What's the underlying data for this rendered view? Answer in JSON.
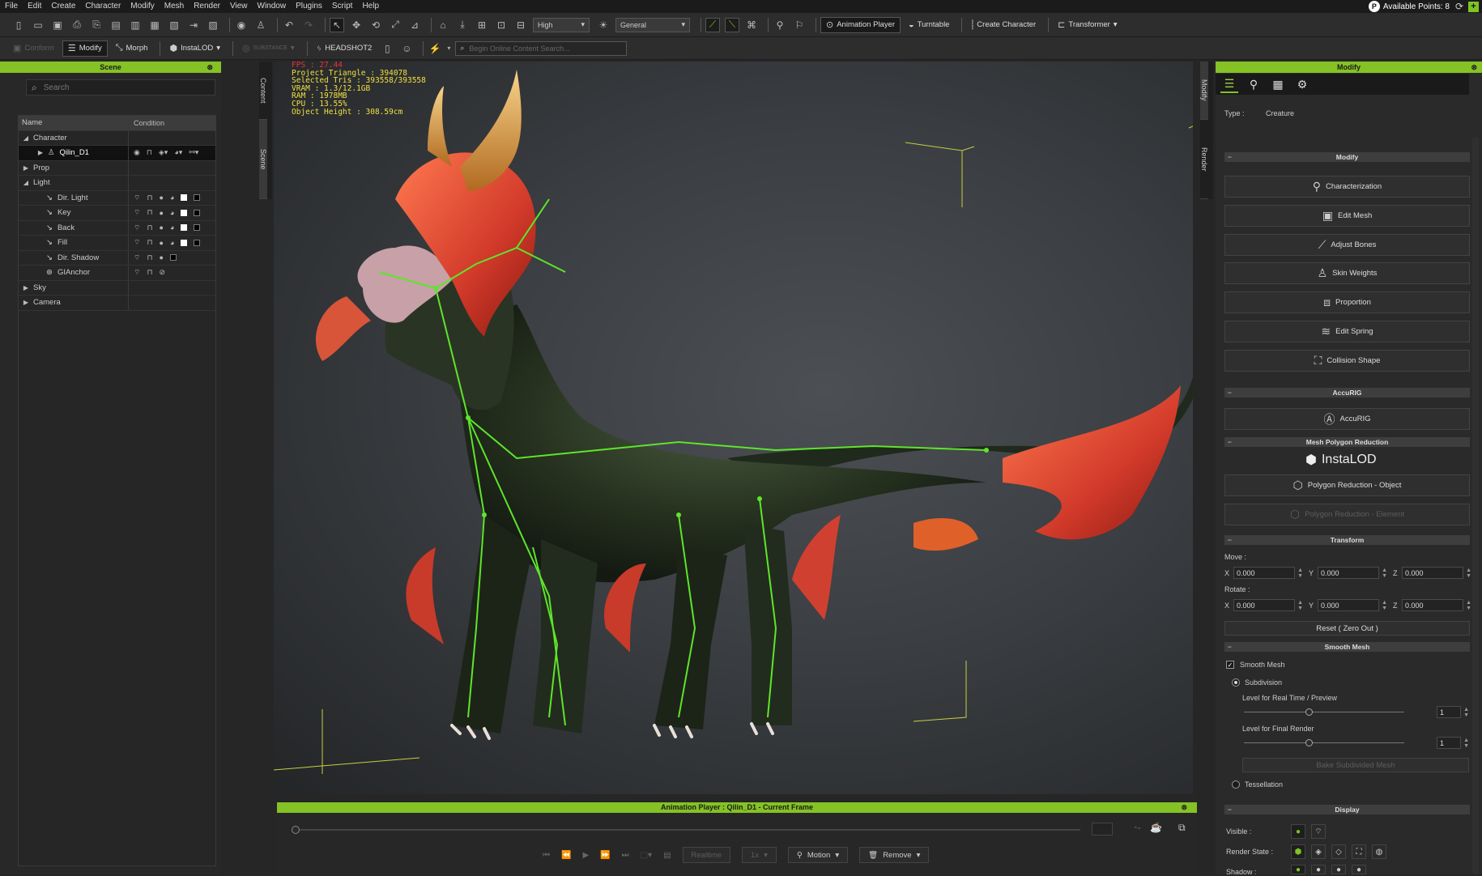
{
  "menu": [
    "File",
    "Edit",
    "Create",
    "Character",
    "Modify",
    "Mesh",
    "Render",
    "View",
    "Window",
    "Plugins",
    "Script",
    "Help"
  ],
  "points_label": "Available Points: 8",
  "toolbar1": {
    "quality": "High",
    "display_mode": "General",
    "animation_player": "Animation Player",
    "turntable": "Turntable",
    "create_character": "Create Character",
    "transformer": "Transformer"
  },
  "toolbar2": {
    "conform": "Conform",
    "modify": "Modify",
    "morph": "Morph",
    "instalod": "InstaLOD",
    "substance": "SUBSTANCE",
    "headshot": "HEADSHOT2",
    "search_placeholder": "Begin Online Content Search..."
  },
  "scene": {
    "title": "Scene",
    "search_placeholder": "Search",
    "col_name": "Name",
    "col_condition": "Condition",
    "rows": [
      {
        "label": "Character",
        "tri": "◢"
      },
      {
        "label": "Qilin_D1",
        "tri": "▶"
      },
      {
        "label": "Prop",
        "tri": "▶"
      },
      {
        "label": "Light",
        "tri": "◢"
      },
      {
        "label": "Dir. Light"
      },
      {
        "label": "Key"
      },
      {
        "label": "Back"
      },
      {
        "label": "Fill"
      },
      {
        "label": "Dir. Shadow"
      },
      {
        "label": "GIAnchor"
      },
      {
        "label": "Sky",
        "tri": "▶"
      },
      {
        "label": "Camera",
        "tri": "▶"
      }
    ]
  },
  "side_tabs_left": [
    "Content",
    "Scene"
  ],
  "side_tabs_right": [
    "Modify",
    "Render"
  ],
  "stats": {
    "fps": "FPS : 27.44",
    "project_triangle": "Project Triangle : 394078",
    "selected_tris": "Selected Tris : 393558/393558",
    "vram": "VRAM : 1.3/12.1GB",
    "ram": "RAM : 1978MB",
    "cpu": "CPU : 13.55%",
    "object_height": "Object Height : 308.59cm"
  },
  "anim_player": {
    "title": "Animation Player : Qilin_D1 - Current Frame",
    "realtime": "Realtime",
    "speed": "1x",
    "motion": "Motion",
    "remove": "Remove"
  },
  "modify": {
    "title": "Modify",
    "type_label": "Type :",
    "type_value": "Creature",
    "section_modify": "Modify",
    "buttons": [
      "Characterization",
      "Edit Mesh",
      "Adjust Bones",
      "Skin Weights",
      "Proportion",
      "Edit Spring",
      "Collision Shape"
    ],
    "section_accurig": "AccuRIG",
    "accurig_button": "AccuRIG",
    "section_reduction": "Mesh Polygon Reduction",
    "instalod_logo": "InstaLOD",
    "poly_object": "Polygon Reduction - Object",
    "poly_element": "Polygon Reduction - Element",
    "section_transform": "Transform",
    "move_label": "Move :",
    "rotate_label": "Rotate :",
    "move": {
      "x": "0.000",
      "y": "0.000",
      "z": "0.000"
    },
    "rotate": {
      "x": "0.000",
      "y": "0.000",
      "z": "0.000"
    },
    "reset": "Reset ( Zero Out )",
    "section_smooth": "Smooth Mesh",
    "smooth_mesh": "Smooth Mesh",
    "subdivision": "Subdivision",
    "level_realtime": "Level for Real Time / Preview",
    "level_final": "Level for Final Render",
    "level_realtime_value": "1",
    "level_final_value": "1",
    "bake": "Bake Subdivided Mesh",
    "tessellation": "Tessellation",
    "section_display": "Display",
    "visible": "Visible :",
    "render_state": "Render State :",
    "shadow": "Shadow :"
  }
}
